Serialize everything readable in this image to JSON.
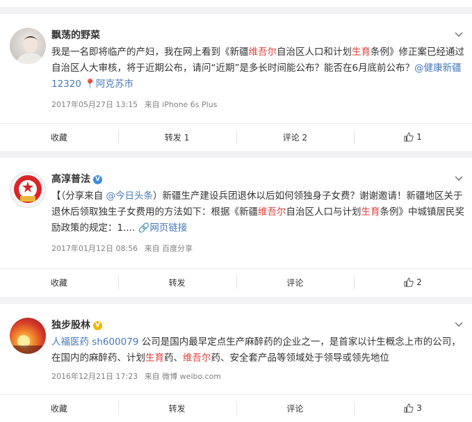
{
  "posts": [
    {
      "user": "飘荡的野菜",
      "verified": "",
      "text": [
        {
          "t": "我是一名即将临产的产妇，我在网上看到《新疆",
          "c": ""
        },
        {
          "t": "维吾尔",
          "c": "red"
        },
        {
          "t": "自治区人口和计划",
          "c": ""
        },
        {
          "t": "生育",
          "c": "red"
        },
        {
          "t": "条例》修正案已经通过自治区人大审核，将于近期公布，请问“近期”是多长时间能公布？能否在6月底前公布？",
          "c": ""
        },
        {
          "t": "@健康新疆12320",
          "c": "link"
        },
        {
          "t": " 📍阿克苏市",
          "c": "link"
        }
      ],
      "time": "2017年05月27日 13:15",
      "source": "来自 iPhone 6s Plus",
      "actions": {
        "collect": "收藏",
        "repost": "转发 1",
        "comment": "评论 2",
        "like": "1"
      }
    },
    {
      "user": "高淳普法",
      "verified": "blue",
      "text": [
        {
          "t": "【（分享来自 ",
          "c": ""
        },
        {
          "t": "@今日头条",
          "c": "link"
        },
        {
          "t": "）新疆生产建设兵团退休以后如何领独身子女费？谢谢邀请！新疆地区关于退休后领取独生子女费用的方法如下：根据《新疆",
          "c": ""
        },
        {
          "t": "维吾尔",
          "c": "red"
        },
        {
          "t": "自治区人口与计划",
          "c": ""
        },
        {
          "t": "生育",
          "c": "red"
        },
        {
          "t": "条例》中城镇居民奖励政策的规定：1.... ",
          "c": ""
        },
        {
          "t": "🔗网页链接",
          "c": "link"
        }
      ],
      "time": "2017年01月12日 08:56",
      "source": "来自 百度分享",
      "actions": {
        "collect": "收藏",
        "repost": "转发",
        "comment": "评论",
        "like": "2"
      }
    },
    {
      "user": "独步股林",
      "verified": "gold",
      "text": [
        {
          "t": "人福医药 sh600079",
          "c": "link"
        },
        {
          "t": " 公司是国内最早定点生产麻醉药的企业之一，是首家以计生概念上市的公司，在国内的麻醉药、计划",
          "c": ""
        },
        {
          "t": "生育",
          "c": "red"
        },
        {
          "t": "药、",
          "c": ""
        },
        {
          "t": "维吾尔",
          "c": "red"
        },
        {
          "t": "药、安全套产品等领域处于领导或领先地位",
          "c": ""
        }
      ],
      "time": "2016年12月21日 17:23",
      "source": "来自 微博 weibo.com",
      "actions": {
        "collect": "收藏",
        "repost": "转发",
        "comment": "评论",
        "like": "3"
      }
    }
  ]
}
